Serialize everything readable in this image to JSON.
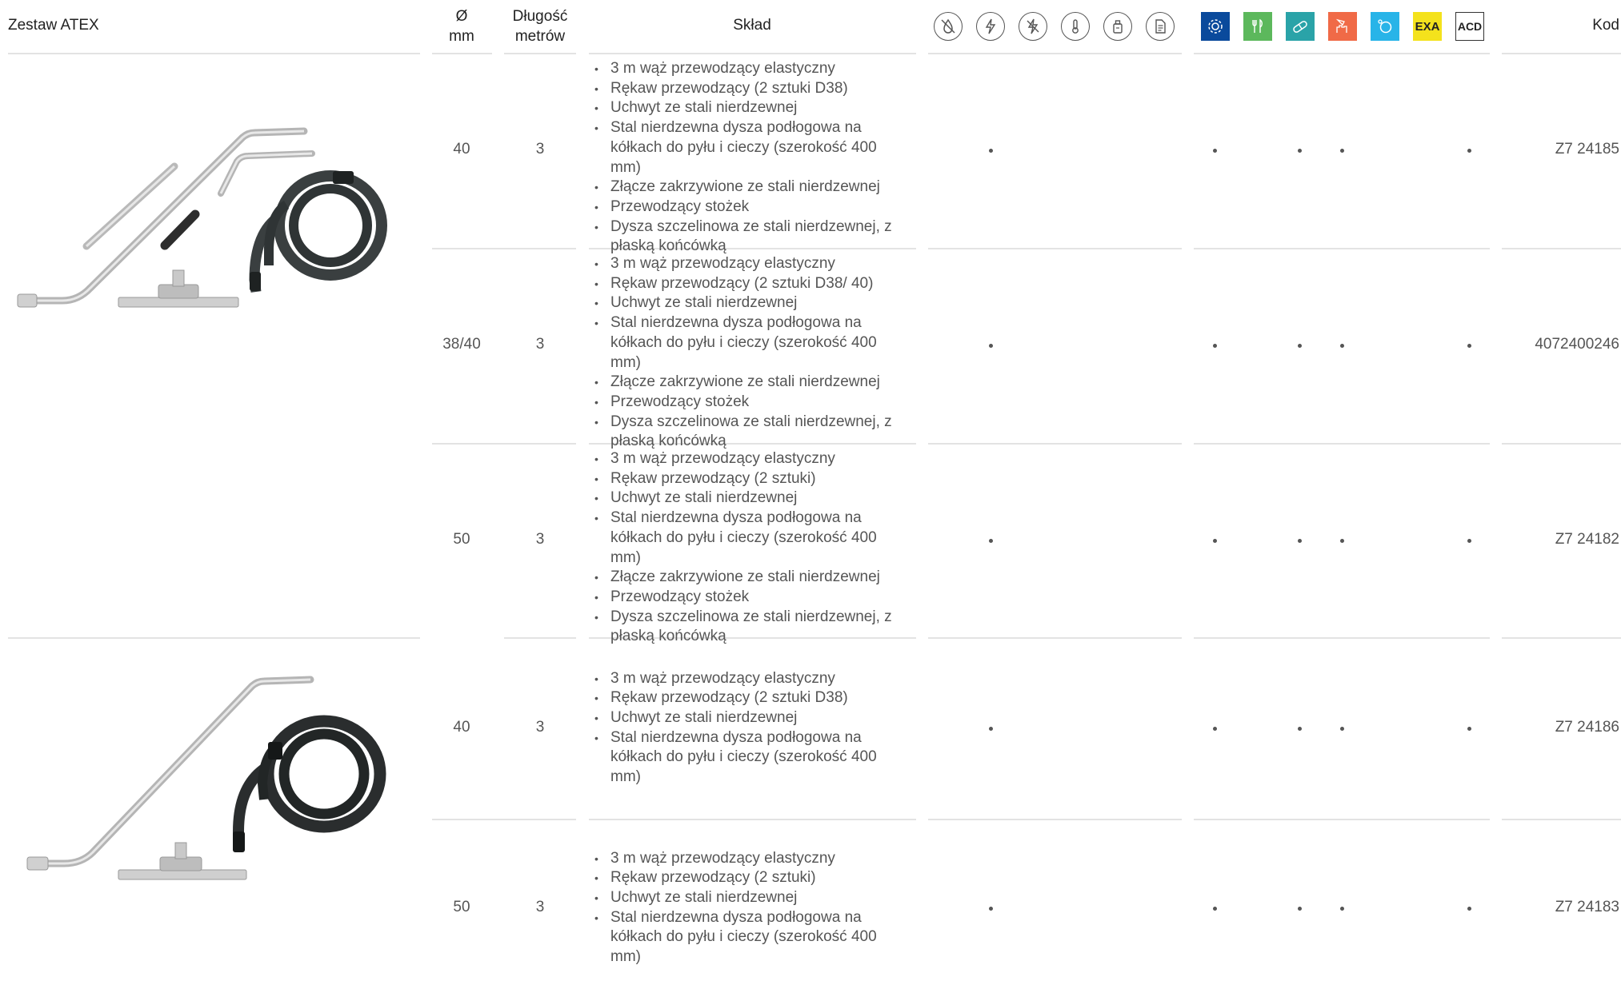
{
  "header": {
    "title": "Zestaw ATEX",
    "diameter_line1": "Ø",
    "diameter_line2": "mm",
    "length_line1": "Długość",
    "length_line2": "metrów",
    "composition": "Skład",
    "code": "Kod",
    "exa_label": "EXA",
    "acd_label": "ACD"
  },
  "icons": {
    "outlined": [
      "no-water-icon",
      "antistatic-icon",
      "no-spark-icon",
      "thermometer-icon",
      "spray-can-icon",
      "document-icon"
    ],
    "applications": [
      {
        "name": "settings-gear-icon",
        "color": "#0a4a9c"
      },
      {
        "name": "food-cutlery-icon",
        "color": "#5cb85c"
      },
      {
        "name": "pharma-pill-icon",
        "color": "#2aa3a8"
      },
      {
        "name": "chemical-hand-icon",
        "color": "#f06a47"
      },
      {
        "name": "bubble-icon",
        "color": "#28b4e8"
      },
      {
        "name": "exa-badge",
        "color": "#f4e21c"
      },
      {
        "name": "acd-badge",
        "color": "#ffffff"
      }
    ]
  },
  "rows": [
    {
      "diameter": "40",
      "length": "3",
      "items": [
        "3 m wąż przewodzący elastyczny",
        "Rękaw przewodzący (2 sztuki D38)",
        "Uchwyt ze stali nierdzewnej",
        "Stal nierdzewna dysza podłogowa na kółkach do pyłu i cieczy (szerokość 400 mm)",
        "Złącze zakrzywione ze stali nierdzewnej",
        "Przewodzący stożek",
        "Dysza szczelinowa ze stali nierdzewnej, z płaską końcówką"
      ],
      "code": "Z7 24185"
    },
    {
      "diameter": "38/40",
      "length": "3",
      "items": [
        "3 m wąż przewodzący elastyczny",
        "Rękaw przewodzący (2 sztuki D38/ 40)",
        "Uchwyt ze stali nierdzewnej",
        "Stal nierdzewna dysza podłogowa na kółkach do pyłu i cieczy (szerokość 400 mm)",
        "Złącze zakrzywione ze stali nierdzewnej",
        "Przewodzący stożek",
        "Dysza szczelinowa ze stali nierdzewnej, z płaską końcówką"
      ],
      "code": "4072400246"
    },
    {
      "diameter": "50",
      "length": "3",
      "items": [
        "3 m wąż przewodzący elastyczny",
        "Rękaw przewodzący (2 sztuki)",
        "Uchwyt ze stali nierdzewnej",
        "Stal nierdzewna dysza podłogowa na kółkach do pyłu i cieczy (szerokość 400 mm)",
        "Złącze zakrzywione ze stali nierdzewnej",
        "Przewodzący stożek",
        "Dysza szczelinowa ze stali nierdzewnej, z płaską końcówką"
      ],
      "code": "Z7 24182"
    },
    {
      "diameter": "40",
      "length": "3",
      "items": [
        "3 m wąż przewodzący elastyczny",
        "Rękaw przewodzący (2 sztuki D38)",
        "Uchwyt ze stali nierdzewnej",
        "Stal nierdzewna dysza podłogowa na kółkach do pyłu i cieczy (szerokość 400 mm)"
      ],
      "code": "Z7 24186"
    },
    {
      "diameter": "50",
      "length": "3",
      "items": [
        "3 m wąż przewodzący elastyczny",
        "Rękaw przewodzący (2 sztuki)",
        "Uchwyt ze stali nierdzewnej",
        "Stal nierdzewna dysza podłogowa na kółkach do pyłu i cieczy (szerokość 400 mm)"
      ],
      "code": "Z7 24183"
    }
  ]
}
